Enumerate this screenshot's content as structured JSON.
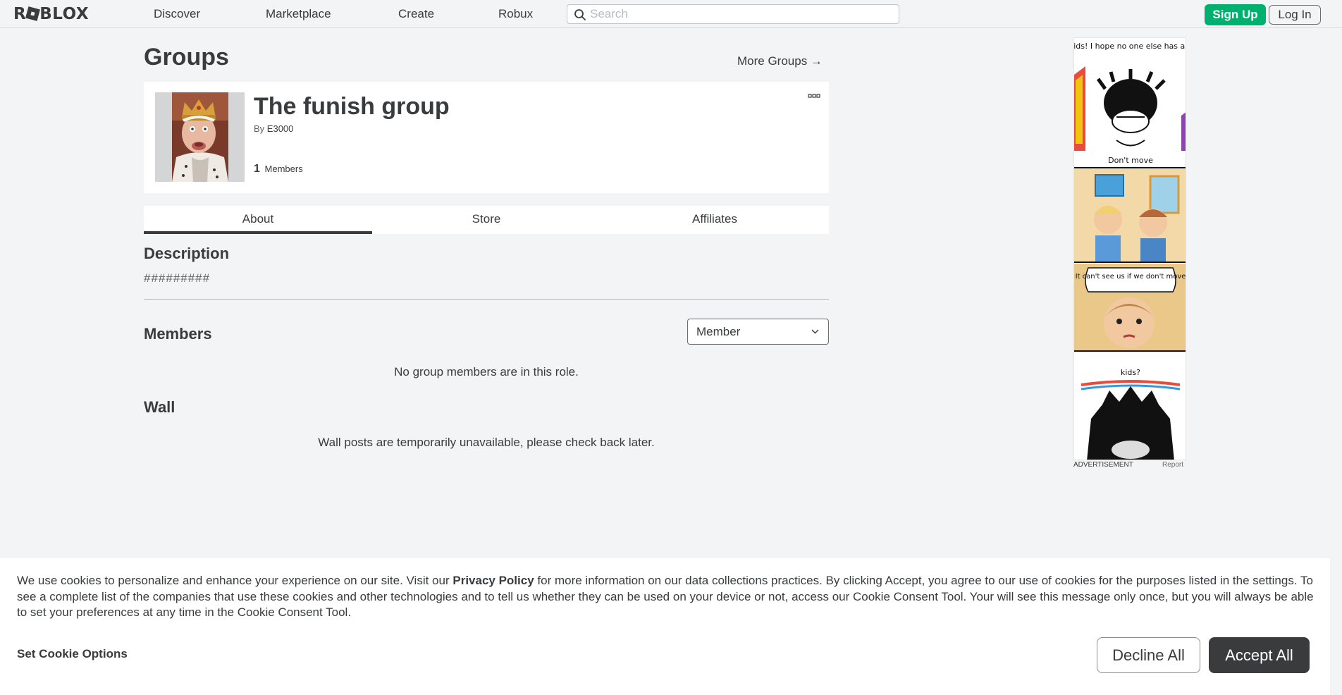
{
  "header": {
    "logo_text_a": "R",
    "logo_text_b": "BLOX",
    "nav": {
      "discover": "Discover",
      "marketplace": "Marketplace",
      "create": "Create",
      "robux": "Robux"
    },
    "search_placeholder": "Search",
    "signup_label": "Sign Up",
    "login_label": "Log In"
  },
  "page": {
    "title": "Groups",
    "more_groups": "More Groups →"
  },
  "group": {
    "name": "The funish group",
    "by_label": "By",
    "owner": "E3000",
    "member_count": "1",
    "members_label": "Members"
  },
  "tabs": {
    "about": "About",
    "store": "Store",
    "affiliates": "Affiliates"
  },
  "about": {
    "description_title": "Description",
    "description_text": "#########",
    "members_title": "Members",
    "role_selected": "Member",
    "no_members_msg": "No group members are in this role.",
    "wall_title": "Wall",
    "wall_msg": "Wall posts are temporarily unavailable, please check back later."
  },
  "ad": {
    "comic_caption_1": "Hey kids! I hope no one else has a bomb",
    "comic_caption_2": "Don't move",
    "comic_caption_3": "It can't see us if we don't move",
    "comic_caption_4": "kids?",
    "label": "ADVERTISEMENT",
    "report": "Report"
  },
  "cookie": {
    "text_part1": "We use cookies to personalize and enhance your experience on our site. Visit our ",
    "privacy_link": "Privacy Policy",
    "text_part2": " for more information on our data collections practices. By clicking Accept, you agree to our use of cookies for the purposes listed in the settings. To see a complete list of the companies that use these cookies and other technologies and to tell us whether they can be used on your device or not, access our Cookie Consent Tool. Your will see this message only once, but you will always be able to set your preferences at any time in the Cookie Consent Tool.",
    "options_label": "Set Cookie Options",
    "decline_label": "Decline All",
    "accept_label": "Accept All"
  },
  "colors": {
    "signup_green": "#00b06f",
    "text_dark": "#393b3d",
    "page_bg": "#f2f4f5"
  }
}
